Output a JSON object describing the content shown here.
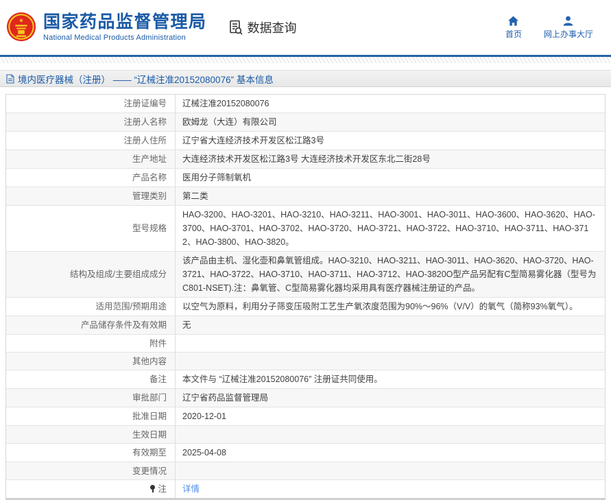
{
  "header": {
    "brand": {
      "title": "国家药品监督管理局",
      "subtitle": "National Medical Products Administration"
    },
    "query_label": "数据查询",
    "nav": [
      {
        "icon": "home-icon",
        "label": "首页"
      },
      {
        "icon": "user-icon",
        "label": "网上办事大厅"
      }
    ]
  },
  "breadcrumb": {
    "text": "境内医疗器械（注册） —— “辽械注准20152080076” 基本信息"
  },
  "table": {
    "rows": [
      {
        "label": "注册证编号",
        "value": "辽械注准20152080076"
      },
      {
        "label": "注册人名称",
        "value": "欧姆龙（大连）有限公司"
      },
      {
        "label": "注册人住所",
        "value": "辽宁省大连经济技术开发区松江路3号"
      },
      {
        "label": "生产地址",
        "value": "大连经济技术开发区松江路3号 大连经济技术开发区东北二街28号"
      },
      {
        "label": "产品名称",
        "value": "医用分子筛制氧机"
      },
      {
        "label": "管理类别",
        "value": "第二类"
      },
      {
        "label": "型号规格",
        "value": "HAO-3200、HAO-3201、HAO-3210、HAO-3211、HAO-3001、HAO-3011、HAO-3600、HAO-3620、HAO-3700、HAO-3701、HAO-3702、HAO-3720、HAO-3721、HAO-3722、HAO-3710、HAO-3711、HAO-3712、HAO-3800、HAO-3820。"
      },
      {
        "label": "结构及组成/主要组成成分",
        "value": "该产品由主机、湿化壶和鼻氧管组成。HAO-3210、HAO-3211、HAO-3011、HAO-3620、HAO-3720、HAO-3721、HAO-3722、HAO-3710、HAO-3711、HAO-3712、HAO-3820O型产品另配有C型简易雾化器（型号为C801-NSET).注：鼻氧管、C型简易雾化器均采用具有医疗器械注册证的产品。"
      },
      {
        "label": "适用范围/预期用途",
        "value": "以空气为原料，利用分子筛变压吸附工艺生产氧浓度范围为90%～96%（V/V）的氧气（简称93%氧气）。"
      },
      {
        "label": "产品储存条件及有效期",
        "value": "无"
      },
      {
        "label": "附件",
        "value": ""
      },
      {
        "label": "其他内容",
        "value": ""
      },
      {
        "label": "备注",
        "value": "本文件与 “辽械注准20152080076” 注册证共同使用。"
      },
      {
        "label": "审批部门",
        "value": "辽宁省药品监督管理局"
      },
      {
        "label": "批准日期",
        "value": "2020-12-01"
      },
      {
        "label": "生效日期",
        "value": ""
      },
      {
        "label": "有效期至",
        "value": "2025-04-08"
      },
      {
        "label": "变更情况",
        "value": ""
      },
      {
        "label": "注",
        "value": "详情"
      }
    ]
  },
  "colors": {
    "brand_blue": "#1a5aa6",
    "header_rule_blue": "#2462a8",
    "link_blue": "#4f8ee8",
    "emblem_red": "#e0281e",
    "emblem_gold": "#f8c81c",
    "row_alt_gray": "#f7f7f7"
  }
}
